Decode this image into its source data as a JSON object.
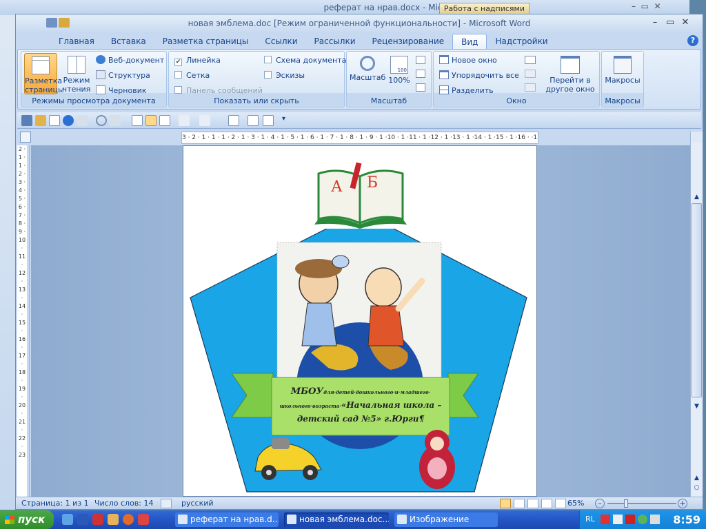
{
  "background_window": {
    "title": "реферат на нрав.docx - Microsoft Word",
    "tools_tab": "Работа с надписями"
  },
  "window": {
    "title": "новая эмблема.doc [Режим ограниченной функциональности] - Microsoft Word"
  },
  "tabs": [
    "Главная",
    "Вставка",
    "Разметка страницы",
    "Ссылки",
    "Рассылки",
    "Рецензирование",
    "Вид",
    "Надстройки"
  ],
  "active_tab": "Вид",
  "ribbon": {
    "views": {
      "label": "Режимы просмотра документа",
      "print_layout": "Разметка страницы",
      "reading": "Режим чтения",
      "web": "Веб-документ",
      "outline": "Структура",
      "draft": "Черновик"
    },
    "show_hide": {
      "label": "Показать или скрыть",
      "ruler": "Линейка",
      "gridlines": "Сетка",
      "message_bar": "Панель сообщений",
      "doc_map": "Схема документа",
      "thumbnails": "Эскизы"
    },
    "zoom": {
      "label": "Масштаб",
      "zoom": "Масштаб",
      "hundred": "100%",
      "hundred_icon_text": "100"
    },
    "window": {
      "label": "Окно",
      "new_window": "Новое окно",
      "arrange_all": "Упорядочить все",
      "split": "Разделить",
      "switch_windows": "Перейти в другое окно"
    },
    "macros": {
      "label": "Макросы",
      "macros": "Макросы"
    }
  },
  "ruler_text": "3 · 2 · 1 · 1 · 1 · 2 · 1 · 3 · 1 · 4 · 1 · 5 · 1 · 6 · 1 · 7 · 1 · 8 · 1 · 9 · 1 ·10 · 1 ·11 · 1 ·12 · 1 ·13 · 1 ·14 · 1 ·15 · 1 ·16 · ·17 ·",
  "vruler_text": "2 · 1 · 1 · 2 · 3 · 4 · 5 · 6 · 7 · 8 · 9 · 10 · 11 · 12 · 13 · 14 · 15 · 16 · 17 · 18 · 19 · 20 · 21 · 22 · 23",
  "emblem": {
    "book_letter_a": "А",
    "book_letter_b": "Б",
    "banner_line1_big": "МБОУ",
    "banner_line1_small": "для·детей·дошкольного·и·младшего·",
    "banner_line2_small": "школьного·возраста·",
    "banner_line2_big": "«Начальная школа –",
    "banner_line3": "детский сад №5» г.Юрги¶"
  },
  "status": {
    "page": "Страница: 1 из 1",
    "words": "Число слов: 14",
    "language": "русский",
    "zoom": "65%"
  },
  "taskbar": {
    "start": "пуск",
    "items": [
      "реферат на нрав.d...",
      "новая эмблема.doc...",
      "Изображение"
    ],
    "lang": "RL",
    "clock": "8:59"
  },
  "colors": {
    "pentagon": "#1aa5e6",
    "banner": "#8fd45a",
    "ribbon_selected": "#f7b848"
  }
}
